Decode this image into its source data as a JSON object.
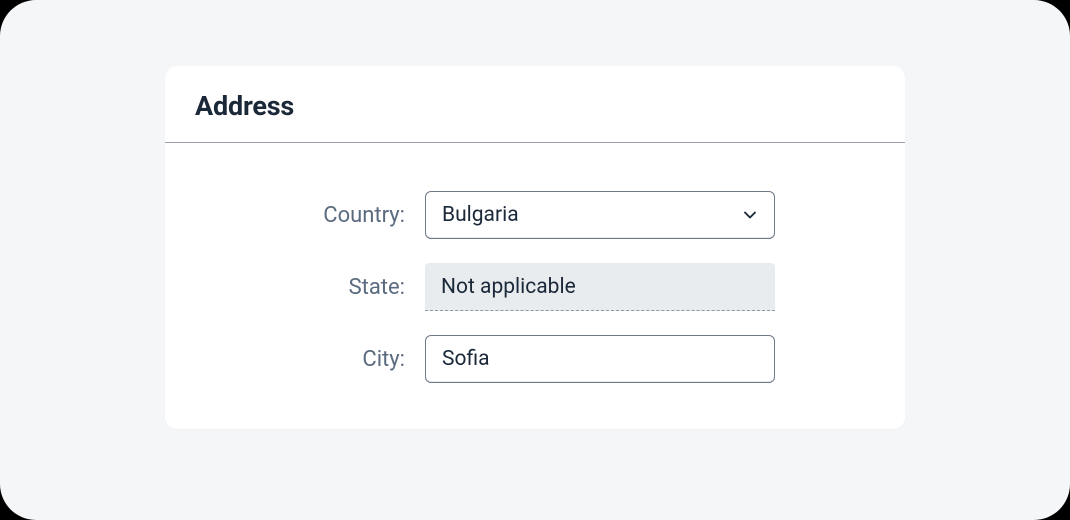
{
  "card": {
    "title": "Address"
  },
  "form": {
    "country": {
      "label": "Country:",
      "value": "Bulgaria"
    },
    "state": {
      "label": "State:",
      "value": "Not applicable"
    },
    "city": {
      "label": "City:",
      "value": "Sofia"
    }
  }
}
